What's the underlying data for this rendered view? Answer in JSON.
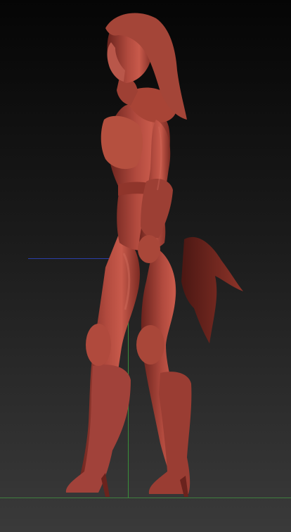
{
  "viewport": {
    "background_top": "#050505",
    "background_bottom": "#3a3a3a",
    "model_color": "#a8453a",
    "model_shadow": "#5a1f1a",
    "model_highlight": "#d47466",
    "axis_colors": {
      "y_axis": "#3a8f3a",
      "x_axis": "#2a3fa8",
      "floor": "#3f7f3f"
    }
  }
}
